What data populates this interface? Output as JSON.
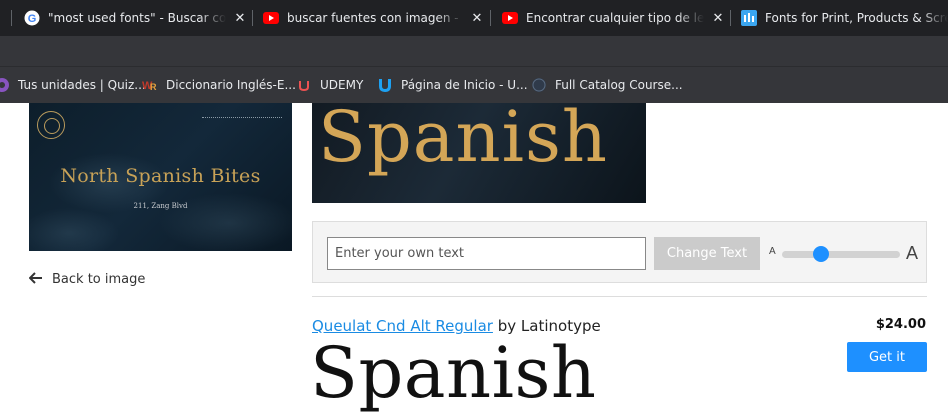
{
  "browser": {
    "tabs": [
      {
        "title": "\"most used fonts\" - Buscar con Google",
        "icon": "google-icon"
      },
      {
        "title": "buscar fuentes con imagen - YouTube",
        "icon": "youtube-icon"
      },
      {
        "title": "Encontrar cualquier tipo de letra",
        "icon": "youtube-icon"
      },
      {
        "title": "Fonts for Print, Products & Screen",
        "icon": "myfonts-icon"
      }
    ],
    "close_glyph": "✕",
    "bookmarks": [
      {
        "label": "Tus unidades | Quiz...",
        "icon": "quizizz-icon"
      },
      {
        "label": "Diccionario Inglés-E...",
        "icon": "wordreference-icon"
      },
      {
        "label": "UDEMY",
        "icon": "udemy-icon"
      },
      {
        "label": "Página de Inicio - U...",
        "icon": "u-icon"
      },
      {
        "label": "Full Catalog Course...",
        "icon": "globe-icon"
      }
    ]
  },
  "preview": {
    "brand": "North Spanish Bites",
    "address": "211, Zang Blvd"
  },
  "back_link": {
    "label": "Back to image"
  },
  "banner": {
    "word": "Spanish"
  },
  "controls": {
    "placeholder": "Enter your own text",
    "change_label": "Change Text",
    "size_small": "A",
    "size_large": "A",
    "size_level": 0.3
  },
  "result": {
    "font_name": "Queulat Cnd Alt Regular",
    "by_text": "by",
    "foundry": "Latinotype",
    "price": "$24.00",
    "get_label": "Get it",
    "sample": "Spanish"
  },
  "colors": {
    "accent": "#1e90ff",
    "link": "#1a8be3",
    "banner_text": "#d4a657",
    "tab_bg": "#202124",
    "bookmark_bg": "#35363a"
  }
}
